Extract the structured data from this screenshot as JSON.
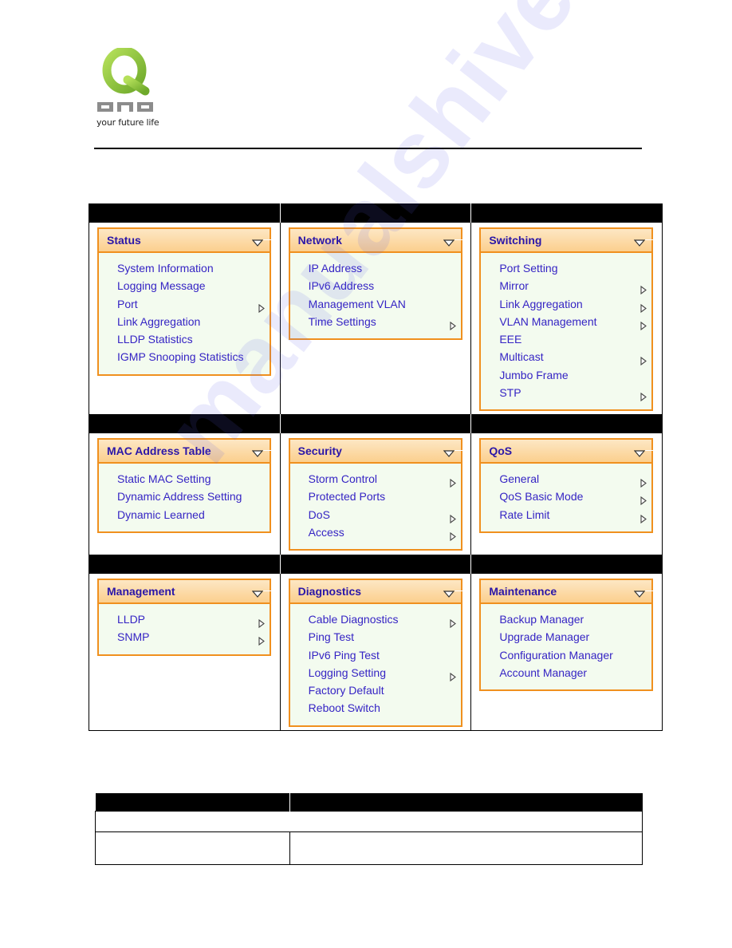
{
  "header": {
    "logo_brand": "QNO",
    "logo_tagline": "your future life",
    "brand_colors": {
      "logo_green": "#8cc63f",
      "logo_gray": "#8c8c8c"
    }
  },
  "colors": {
    "panel_border": "#f0901e",
    "panel_body": "#f3fbef",
    "menu_text": "#3524c4",
    "title_text": "#2a16a8"
  },
  "watermark": "manualshive.com",
  "menus": [
    {
      "title": "Status",
      "items": [
        {
          "label": "System Information",
          "submenu": false
        },
        {
          "label": "Logging Message",
          "submenu": false
        },
        {
          "label": "Port",
          "submenu": true
        },
        {
          "label": "Link Aggregation",
          "submenu": false
        },
        {
          "label": "LLDP Statistics",
          "submenu": false
        },
        {
          "label": "IGMP Snooping Statistics",
          "submenu": false
        }
      ]
    },
    {
      "title": "Network",
      "items": [
        {
          "label": "IP Address",
          "submenu": false
        },
        {
          "label": "IPv6 Address",
          "submenu": false
        },
        {
          "label": "Management VLAN",
          "submenu": false
        },
        {
          "label": "Time Settings",
          "submenu": true
        }
      ]
    },
    {
      "title": "Switching",
      "items": [
        {
          "label": "Port Setting",
          "submenu": false
        },
        {
          "label": "Mirror",
          "submenu": true
        },
        {
          "label": "Link Aggregation",
          "submenu": true
        },
        {
          "label": "VLAN Management",
          "submenu": true
        },
        {
          "label": "EEE",
          "submenu": false
        },
        {
          "label": "Multicast",
          "submenu": true
        },
        {
          "label": "Jumbo Frame",
          "submenu": false
        },
        {
          "label": "STP",
          "submenu": true
        }
      ]
    },
    {
      "title": "MAC Address Table",
      "items": [
        {
          "label": "Static MAC Setting",
          "submenu": false
        },
        {
          "label": "Dynamic Address Setting",
          "submenu": false
        },
        {
          "label": "Dynamic Learned",
          "submenu": false
        }
      ]
    },
    {
      "title": "Security",
      "items": [
        {
          "label": "Storm Control",
          "submenu": true
        },
        {
          "label": "Protected Ports",
          "submenu": false
        },
        {
          "label": "DoS",
          "submenu": true
        },
        {
          "label": "Access",
          "submenu": true
        }
      ]
    },
    {
      "title": "QoS",
      "items": [
        {
          "label": "General",
          "submenu": true
        },
        {
          "label": "QoS Basic Mode",
          "submenu": true
        },
        {
          "label": "Rate Limit",
          "submenu": true
        }
      ]
    },
    {
      "title": "Management",
      "items": [
        {
          "label": "LLDP",
          "submenu": true
        },
        {
          "label": "SNMP",
          "submenu": true
        }
      ]
    },
    {
      "title": "Diagnostics",
      "items": [
        {
          "label": "Cable Diagnostics",
          "submenu": true
        },
        {
          "label": "Ping Test",
          "submenu": false
        },
        {
          "label": "IPv6 Ping Test",
          "submenu": false
        },
        {
          "label": "Logging Setting",
          "submenu": true
        },
        {
          "label": "Factory Default",
          "submenu": false
        },
        {
          "label": "Reboot Switch",
          "submenu": false
        }
      ]
    },
    {
      "title": "Maintenance",
      "items": [
        {
          "label": "Backup Manager",
          "submenu": false
        },
        {
          "label": "Upgrade Manager",
          "submenu": false
        },
        {
          "label": "Configuration Manager",
          "submenu": false
        },
        {
          "label": "Account Manager",
          "submenu": false
        }
      ]
    }
  ]
}
